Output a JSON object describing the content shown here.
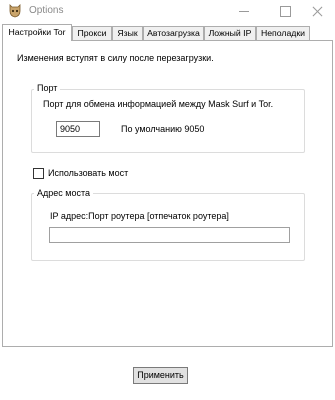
{
  "window": {
    "title": "Options",
    "icon": "mask-surf-icon"
  },
  "tabs": [
    {
      "label": "Настройки Tor",
      "active": true
    },
    {
      "label": "Прокси",
      "active": false
    },
    {
      "label": "Язык",
      "active": false
    },
    {
      "label": "Автозагрузка",
      "active": false
    },
    {
      "label": "Ложный IP",
      "active": false
    },
    {
      "label": "Неполадки",
      "active": false
    }
  ],
  "tor_settings": {
    "notice": "Изменения вступят в силу после перезагрузки.",
    "port_group": {
      "title": "Порт",
      "description": "Порт для обмена информацией между Mask Surf и Tor.",
      "port_value": "9050",
      "default_text": "По умолчанию 9050"
    },
    "use_bridge": {
      "label": "Использовать мост",
      "checked": false
    },
    "bridge_group": {
      "title": "Адрес моста",
      "description": "IP адрес:Порт роутера [отпечаток роутера]",
      "address_value": ""
    }
  },
  "footer": {
    "apply_label": "Применить"
  }
}
